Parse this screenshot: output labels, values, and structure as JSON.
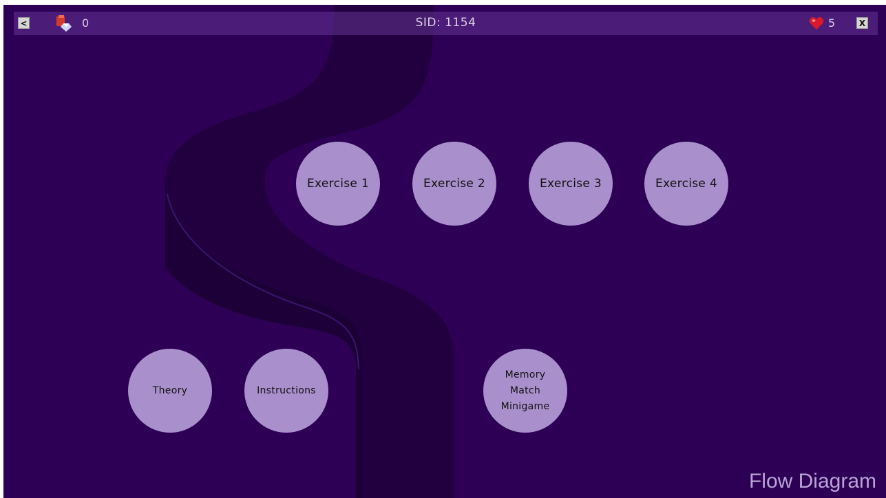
{
  "header": {
    "back_label": "<",
    "gems_count": "0",
    "sid_text": "SID: 1154",
    "lives_count": "5",
    "close_label": "X"
  },
  "nodes": {
    "exercise_1": "Exercise 1",
    "exercise_2": "Exercise 2",
    "exercise_3": "Exercise 3",
    "exercise_4": "Exercise 4",
    "theory": "Theory",
    "instructions": "Instructions",
    "memory_match": "Memory\nMatch\nMinigame"
  },
  "footer": {
    "label": "Flow Diagram"
  },
  "colors": {
    "background": "#2d0055",
    "node_fill": "#a98fcc",
    "road": "#220040"
  }
}
